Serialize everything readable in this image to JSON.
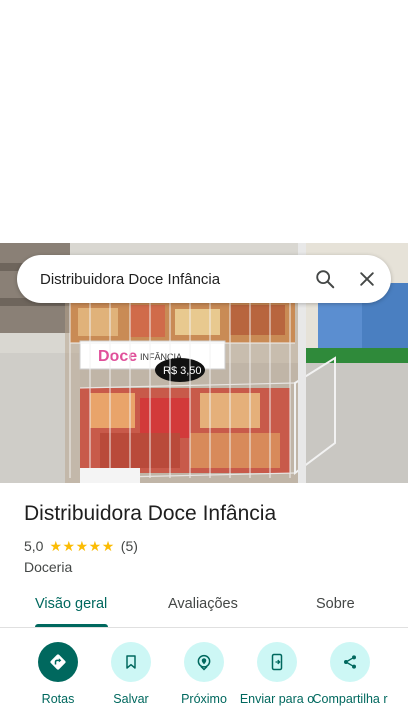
{
  "search": {
    "query": "Distribuidora Doce Infância",
    "search_icon": "search-icon",
    "close_icon": "close-icon"
  },
  "photo": {
    "sign_brand": "Doce",
    "sign_sub": "INFÂNCIA",
    "price_tag": "R$ 3,50"
  },
  "place": {
    "title": "Distribuidora Doce Infância",
    "rating": "5,0",
    "stars": 5,
    "review_count": "(5)",
    "category": "Doceria"
  },
  "tabs": [
    {
      "label": "Visão geral",
      "active": true
    },
    {
      "label": "Avaliações",
      "active": false
    },
    {
      "label": "Sobre",
      "active": false
    }
  ],
  "actions": [
    {
      "label": "Rotas",
      "icon": "directions-icon"
    },
    {
      "label": "Salvar",
      "icon": "bookmark-icon"
    },
    {
      "label": "Próximo",
      "icon": "nearby-icon"
    },
    {
      "label": "Enviar para o",
      "icon": "send-to-phone-icon"
    },
    {
      "label": "Compartilha r",
      "icon": "share-icon"
    }
  ],
  "colors": {
    "accent": "#00685e",
    "action_bg": "#cdf7f5",
    "star": "#fbbc04"
  }
}
